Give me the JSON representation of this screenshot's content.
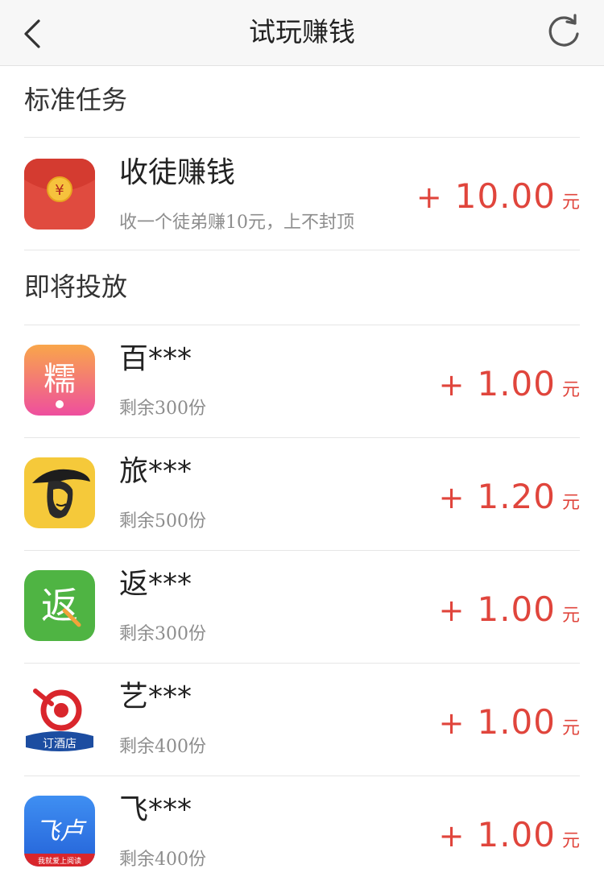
{
  "nav": {
    "title": "试玩赚钱",
    "back_icon": "chevron-left-icon",
    "refresh_icon": "refresh-icon"
  },
  "sections": {
    "standard": "标准任务",
    "upcoming": "即将投放"
  },
  "standard_task": {
    "name": "收徒赚钱",
    "desc": "收一个徒弟赚10元，上不封顶",
    "plus": "+",
    "amount": "10.00",
    "unit": "元",
    "icon": "red-envelope-icon"
  },
  "tasks": [
    {
      "name": "百***",
      "remain": "剩余300份",
      "plus": "+",
      "amount": "1.00",
      "unit": "元",
      "icon": "nuomi-app-icon",
      "icon_text": "糯"
    },
    {
      "name": "旅***",
      "remain": "剩余500份",
      "plus": "+",
      "amount": "1.20",
      "unit": "元",
      "icon": "musketeer-app-icon"
    },
    {
      "name": "返***",
      "remain": "剩余300份",
      "plus": "+",
      "amount": "1.00",
      "unit": "元",
      "icon": "rebate-app-icon",
      "icon_text": "返"
    },
    {
      "name": "艺***",
      "remain": "剩余400份",
      "plus": "+",
      "amount": "1.00",
      "unit": "元",
      "icon": "elong-hotel-app-icon",
      "icon_text": "订酒店"
    },
    {
      "name": "飞***",
      "remain": "剩余400份",
      "plus": "+",
      "amount": "1.00",
      "unit": "元",
      "icon": "feilu-reader-app-icon",
      "icon_text": "飞卢",
      "icon_subtext": "我就爱上阅读"
    }
  ],
  "colors": {
    "accent": "#e0453c",
    "divider": "#e6e6e6",
    "subtext": "#8d8d8d"
  }
}
